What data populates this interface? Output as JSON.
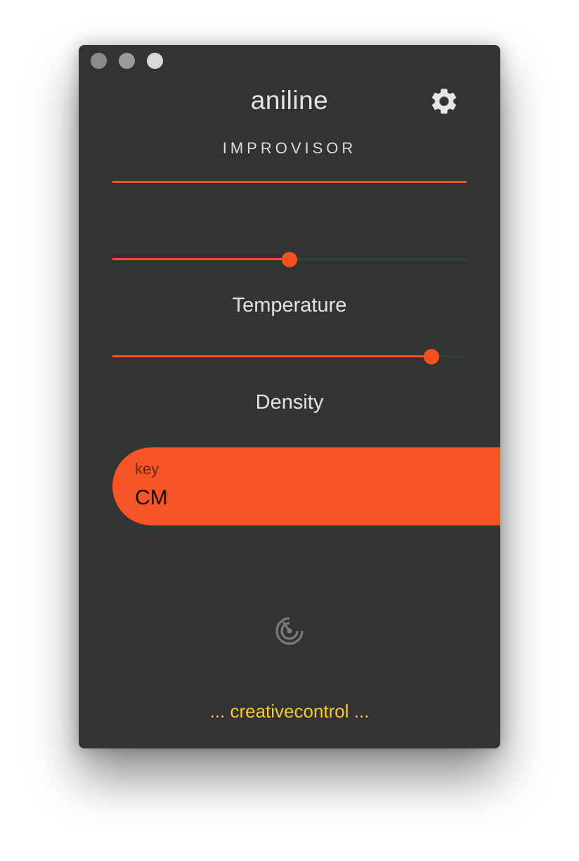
{
  "app": {
    "title": "aniline",
    "subtitle": "IMPROVISOR",
    "accent_color": "#f4511e",
    "background_color": "#333333"
  },
  "window_controls": [
    "close",
    "minimize",
    "zoom"
  ],
  "toolbar": {
    "settings_icon": "gear-icon"
  },
  "sliders": [
    {
      "label": "Temperature",
      "value": 0.5
    },
    {
      "label": "Density",
      "value": 0.9
    }
  ],
  "key_select": {
    "label": "key",
    "value": "CM"
  },
  "action": {
    "icon": "radar-icon"
  },
  "footer": {
    "text": "... creativecontrol ...",
    "color": "#f9c824"
  }
}
